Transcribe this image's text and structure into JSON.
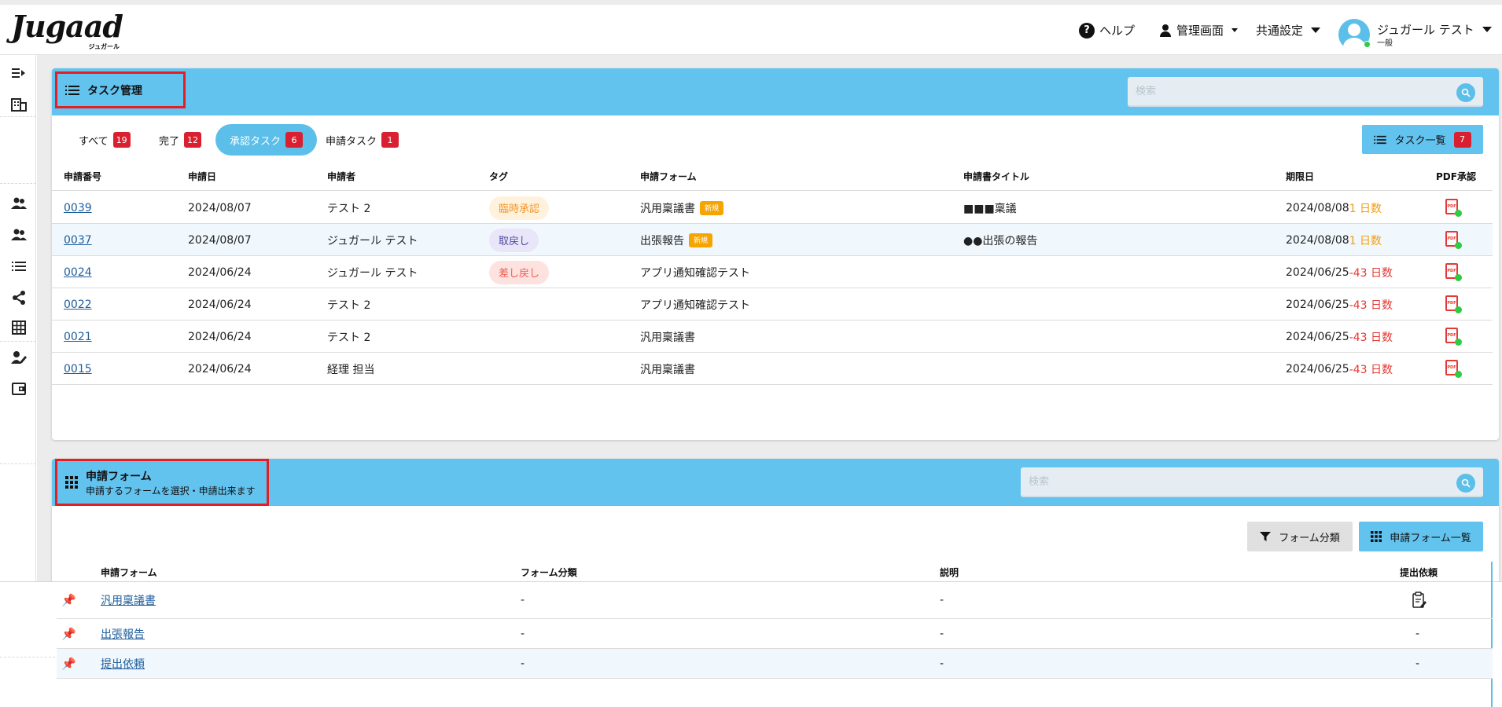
{
  "header": {
    "logo_text": "Jugaad",
    "logo_sub": "ジュガール",
    "help_label": "ヘルプ",
    "admin_label": "管理画面",
    "settings_label": "共通設定",
    "user_name": "ジュガール テスト",
    "user_role": "一般"
  },
  "task_panel": {
    "title": "タスク管理",
    "search_placeholder": "検索",
    "filters": [
      {
        "label": "すべて",
        "count": "19"
      },
      {
        "label": "完了",
        "count": "12"
      },
      {
        "label": "承認タスク",
        "count": "6"
      },
      {
        "label": "申請タスク",
        "count": "1"
      }
    ],
    "list_button": {
      "label": "タスク一覧",
      "count": "7"
    },
    "columns": [
      "申請番号",
      "申請日",
      "申請者",
      "タグ",
      "申請フォーム",
      "申請書タイトル",
      "期限日",
      "PDF承認"
    ],
    "rows": [
      {
        "no": "0039",
        "date": "2024/08/07",
        "applicant": "テスト 2",
        "tag": "臨時承認",
        "tag_style": "orange",
        "form": "汎用稟議書",
        "is_new": true,
        "new_label": "新規",
        "title": "■■■稟議",
        "deadline": "2024/08/08",
        "days": "1 日数",
        "days_style": "orange"
      },
      {
        "no": "0037",
        "date": "2024/08/07",
        "applicant": "ジュガール テスト",
        "tag": "取戻し",
        "tag_style": "purple",
        "form": "出張報告",
        "is_new": true,
        "new_label": "新規",
        "title": "●●出張の報告",
        "deadline": "2024/08/08",
        "days": "1 日数",
        "days_style": "orange"
      },
      {
        "no": "0024",
        "date": "2024/06/24",
        "applicant": "ジュガール テスト",
        "tag": "差し戻し",
        "tag_style": "red",
        "form": "アプリ通知確認テスト",
        "is_new": false,
        "new_label": "",
        "title": "",
        "deadline": "2024/06/25",
        "days": "-43 日数",
        "days_style": "red"
      },
      {
        "no": "0022",
        "date": "2024/06/24",
        "applicant": "テスト 2",
        "tag": "",
        "tag_style": "",
        "form": "アプリ通知確認テスト",
        "is_new": false,
        "new_label": "",
        "title": "",
        "deadline": "2024/06/25",
        "days": "-43 日数",
        "days_style": "red"
      },
      {
        "no": "0021",
        "date": "2024/06/24",
        "applicant": "テスト 2",
        "tag": "",
        "tag_style": "",
        "form": "汎用稟議書",
        "is_new": false,
        "new_label": "",
        "title": "",
        "deadline": "2024/06/25",
        "days": "-43 日数",
        "days_style": "red"
      },
      {
        "no": "0015",
        "date": "2024/06/24",
        "applicant": "経理 担当",
        "tag": "",
        "tag_style": "",
        "form": "汎用稟議書",
        "is_new": false,
        "new_label": "",
        "title": "",
        "deadline": "2024/06/25",
        "days": "-43 日数",
        "days_style": "red"
      }
    ]
  },
  "form_panel": {
    "title": "申請フォーム",
    "subtitle": "申請するフォームを選択・申請出来ます",
    "search_placeholder": "検索",
    "category_button": "フォーム分類",
    "list_button": "申請フォーム一覧",
    "columns": [
      "申請フォーム",
      "フォーム分類",
      "説明",
      "提出依頼"
    ],
    "rows": [
      {
        "name": "汎用稟議書",
        "category": "-",
        "description": "-",
        "request": ""
      },
      {
        "name": "出張報告",
        "category": "-",
        "description": "-",
        "request": "-"
      },
      {
        "name": "提出依頼",
        "category": "-",
        "description": "-",
        "request": "-"
      }
    ]
  },
  "colors": {
    "accent": "#63c3ef",
    "highlight_box": "#e31e24",
    "badge_red": "#d92030",
    "new_badge": "#f5a400"
  }
}
